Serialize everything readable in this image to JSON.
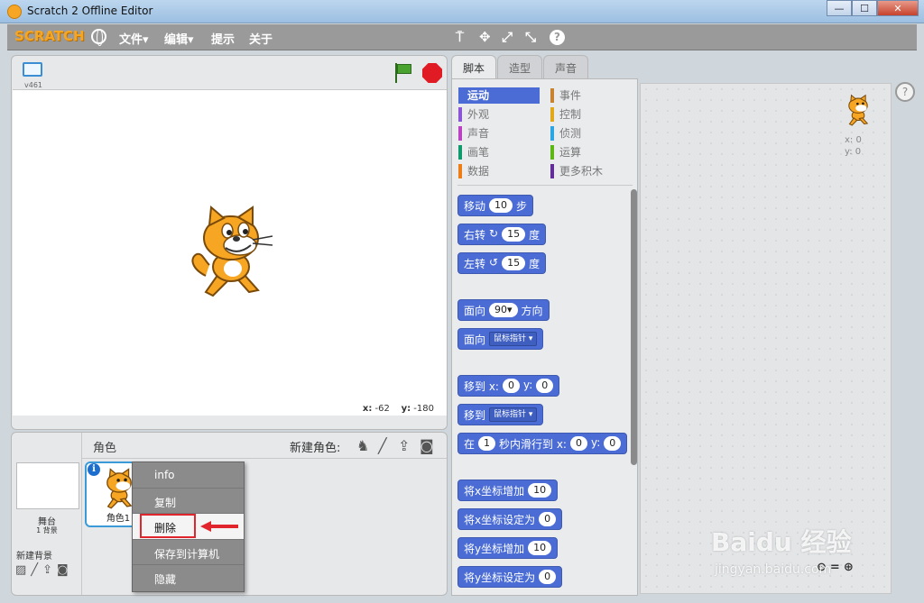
{
  "window": {
    "title": "Scratch 2 Offline Editor",
    "min": "—",
    "max": "☐",
    "close": "✕"
  },
  "menubar": {
    "logo": "SCRATCH",
    "file": "文件▾",
    "edit": "编辑▾",
    "tips": "提示",
    "about": "关于",
    "tools": [
      "⍑",
      "✥",
      "⤢",
      "⤡",
      "?"
    ]
  },
  "stage": {
    "version": "v461",
    "coord_x_label": "x:",
    "coord_x": "-62",
    "coord_y_label": "y:",
    "coord_y": "-180"
  },
  "sprites": {
    "title": "角色",
    "new_sprite_label": "新建角色:",
    "stage_name": "舞台",
    "stage_backdrops": "1 背景",
    "new_backdrop_label": "新建背景",
    "sprite_name": "角色1",
    "info_badge": "i"
  },
  "context_menu": {
    "items": [
      "info",
      "复制",
      "删除",
      "保存到计算机",
      "隐藏"
    ],
    "highlighted_index": 2
  },
  "tabs": [
    "脚本",
    "造型",
    "声音"
  ],
  "categories": [
    {
      "label": "运动",
      "color": "#4a6cd4"
    },
    {
      "label": "事件",
      "color": "#c88330"
    },
    {
      "label": "外观",
      "color": "#8a55d7"
    },
    {
      "label": "控制",
      "color": "#e1a91a"
    },
    {
      "label": "声音",
      "color": "#bb42c3"
    },
    {
      "label": "侦测",
      "color": "#2ca5e2"
    },
    {
      "label": "画笔",
      "color": "#0e9a6c"
    },
    {
      "label": "运算",
      "color": "#5cb712"
    },
    {
      "label": "数据",
      "color": "#ee7d16"
    },
    {
      "label": "更多积木",
      "color": "#632d99"
    }
  ],
  "blocks": {
    "move": {
      "a": "移动",
      "v": "10",
      "b": "步"
    },
    "turn_right": {
      "a": "右转",
      "icon": "↻",
      "v": "15",
      "b": "度"
    },
    "turn_left": {
      "a": "左转",
      "icon": "↺",
      "v": "15",
      "b": "度"
    },
    "point_dir": {
      "a": "面向",
      "v": "90▾",
      "b": "方向"
    },
    "point_towards": {
      "a": "面向",
      "drop": "鼠标指针 ▾"
    },
    "goto_xy": {
      "a": "移到 x:",
      "v1": "0",
      "mid": "y:",
      "v2": "0"
    },
    "goto": {
      "a": "移到",
      "drop": "鼠标指针 ▾"
    },
    "glide": {
      "a": "在",
      "v0": "1",
      "mid0": "秒内滑行到 x:",
      "v1": "0",
      "mid": "y:",
      "v2": "0"
    },
    "change_x": {
      "a": "将x坐标增加",
      "v": "10"
    },
    "set_x": {
      "a": "将x坐标设定为",
      "v": "0"
    },
    "change_y": {
      "a": "将y坐标增加",
      "v": "10"
    },
    "set_y": {
      "a": "将y坐标设定为",
      "v": "0"
    }
  },
  "scripts_area": {
    "x": "x: 0",
    "y": "y: 0",
    "help": "?"
  },
  "watermark": {
    "main": "Baidu 经验",
    "sub": "jingyan.baidu.com"
  }
}
